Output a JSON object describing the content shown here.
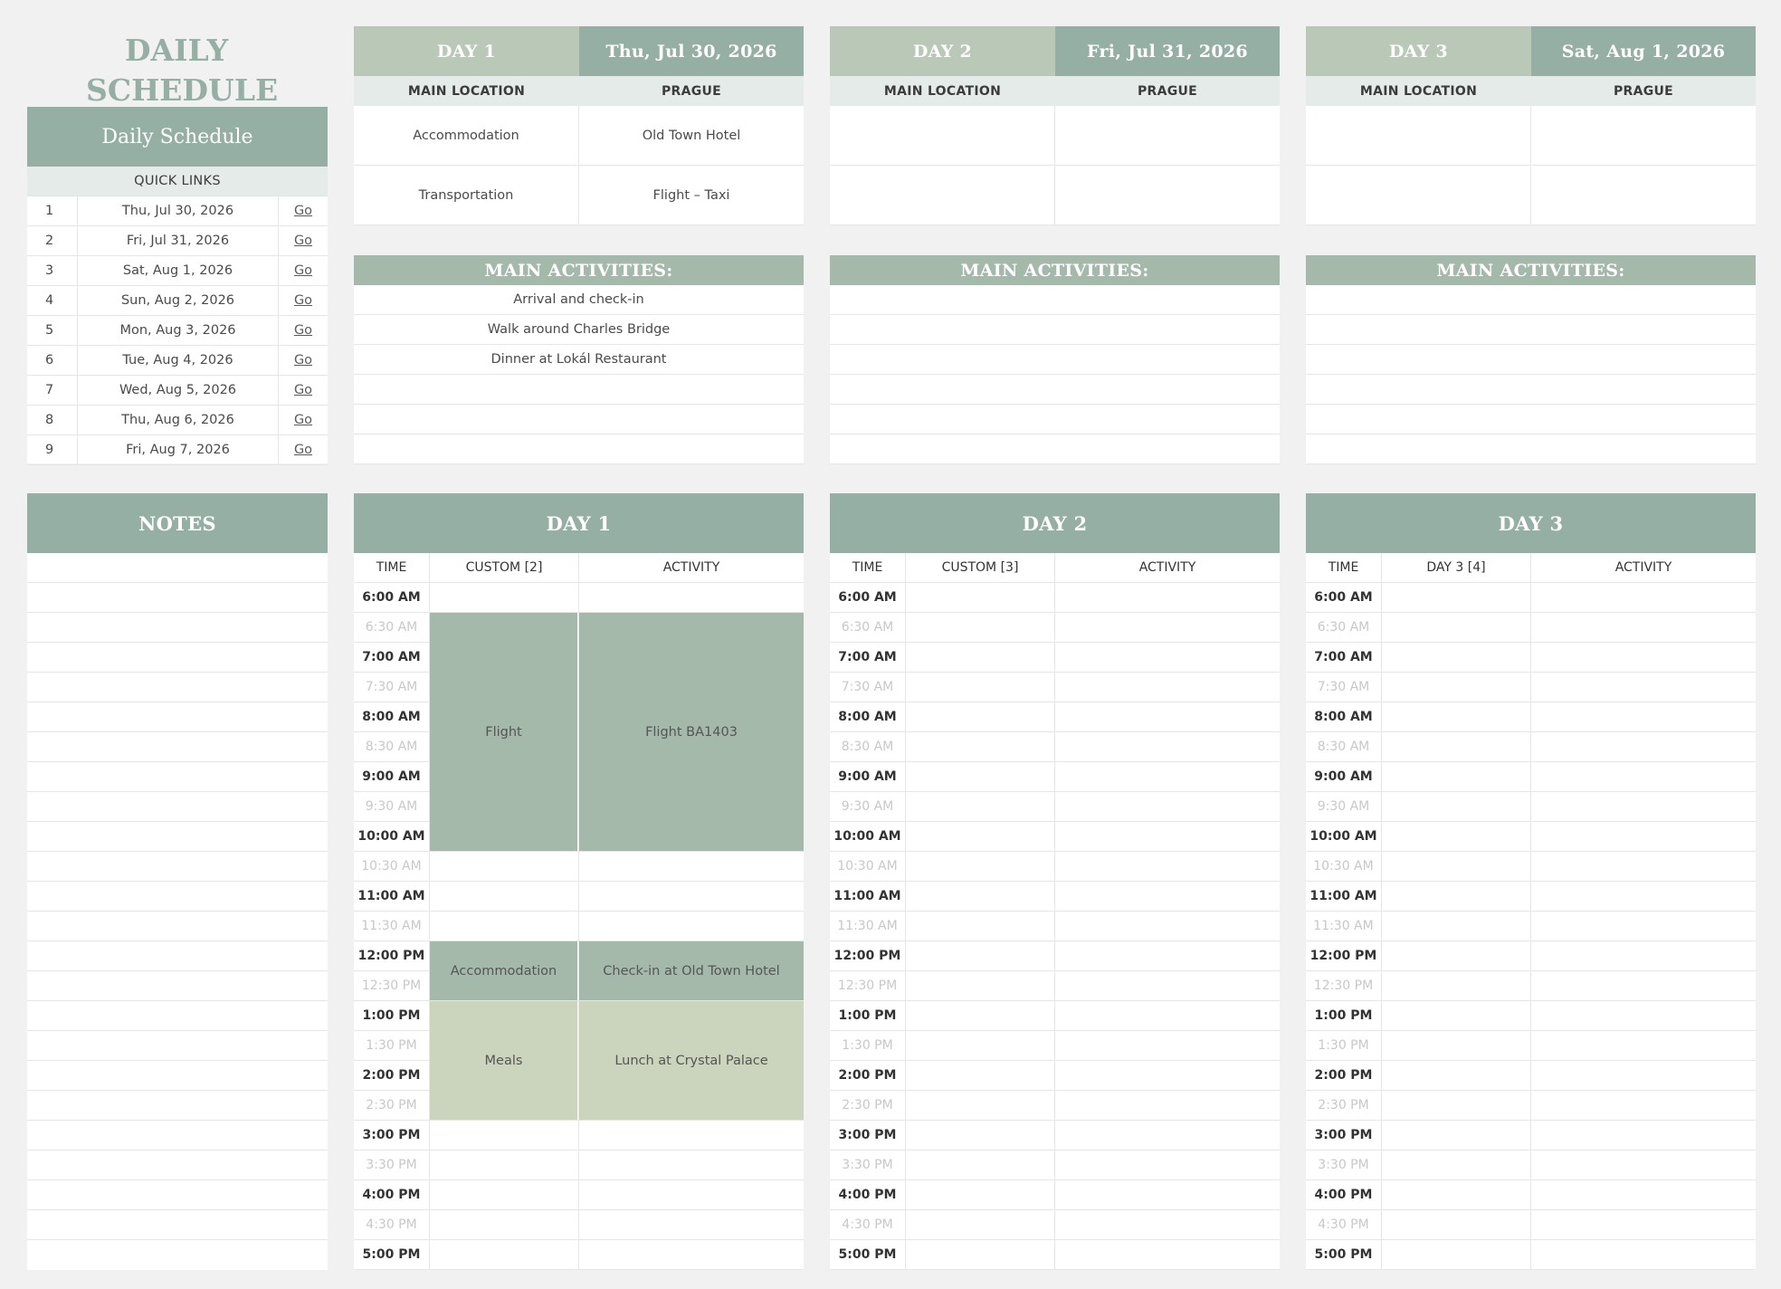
{
  "page_title": "DAILY SCHEDULE",
  "sidebar": {
    "panel_title": "Daily Schedule",
    "quick_links_label": "QUICK LINKS",
    "links": [
      {
        "n": "1",
        "date": "Thu, Jul 30, 2026",
        "go": "Go"
      },
      {
        "n": "2",
        "date": "Fri, Jul 31, 2026",
        "go": "Go"
      },
      {
        "n": "3",
        "date": "Sat, Aug 1, 2026",
        "go": "Go"
      },
      {
        "n": "4",
        "date": "Sun, Aug 2, 2026",
        "go": "Go"
      },
      {
        "n": "5",
        "date": "Mon, Aug 3, 2026",
        "go": "Go"
      },
      {
        "n": "6",
        "date": "Tue, Aug 4, 2026",
        "go": "Go"
      },
      {
        "n": "7",
        "date": "Wed, Aug 5, 2026",
        "go": "Go"
      },
      {
        "n": "8",
        "date": "Thu, Aug 6, 2026",
        "go": "Go"
      },
      {
        "n": "9",
        "date": "Fri, Aug 7, 2026",
        "go": "Go"
      }
    ],
    "notes_label": "NOTES"
  },
  "days": [
    {
      "label": "DAY 1",
      "date": "Thu, Jul 30, 2026",
      "location_label": "MAIN LOCATION",
      "location": "PRAGUE",
      "info": [
        [
          "Accommodation",
          "Old Town Hotel"
        ],
        [
          "Transportation",
          "Flight – Taxi"
        ]
      ],
      "activities_label": "MAIN ACTIVITIES:",
      "activities": [
        "Arrival and check-in",
        "Walk around Charles Bridge",
        "Dinner at Lokál Restaurant",
        "",
        "",
        ""
      ],
      "schedule_title": "DAY 1",
      "col_time": "TIME",
      "col_custom": "CUSTOM [2]",
      "col_activity": "ACTIVITY"
    },
    {
      "label": "DAY 2",
      "date": "Fri, Jul 31, 2026",
      "location_label": "MAIN LOCATION",
      "location": "PRAGUE",
      "info": [
        [
          "",
          ""
        ],
        [
          "",
          ""
        ]
      ],
      "activities_label": "MAIN ACTIVITIES:",
      "activities": [
        "",
        "",
        "",
        "",
        "",
        ""
      ],
      "schedule_title": "DAY 2",
      "col_time": "TIME",
      "col_custom": "CUSTOM [3]",
      "col_activity": "ACTIVITY"
    },
    {
      "label": "DAY 3",
      "date": "Sat, Aug 1, 2026",
      "location_label": "MAIN LOCATION",
      "location": "PRAGUE",
      "info": [
        [
          "",
          ""
        ],
        [
          "",
          ""
        ]
      ],
      "activities_label": "MAIN ACTIVITIES:",
      "activities": [
        "",
        "",
        "",
        "",
        "",
        ""
      ],
      "schedule_title": "DAY 3",
      "col_time": "TIME",
      "col_custom": "DAY 3 [4]",
      "col_activity": "ACTIVITY"
    }
  ],
  "times": [
    "6:00 AM",
    "6:30 AM",
    "7:00 AM",
    "7:30 AM",
    "8:00 AM",
    "8:30 AM",
    "9:00 AM",
    "9:30 AM",
    "10:00 AM",
    "10:30 AM",
    "11:00 AM",
    "11:30 AM",
    "12:00 PM",
    "12:30 PM",
    "1:00 PM",
    "1:30 PM",
    "2:00 PM",
    "2:30 PM",
    "3:00 PM",
    "3:30 PM",
    "4:00 PM",
    "4:30 PM",
    "5:00 PM"
  ],
  "day1_events": [
    {
      "start": 1,
      "end": 8,
      "custom": "Flight",
      "activity": "Flight BA1403",
      "style": "evt1"
    },
    {
      "start": 12,
      "end": 13,
      "custom": "Accommodation",
      "activity": "Check-in at Old Town Hotel",
      "style": "evt1"
    },
    {
      "start": 14,
      "end": 17,
      "custom": "Meals",
      "activity": "Lunch at Crystal Palace",
      "style": "evt2"
    }
  ]
}
